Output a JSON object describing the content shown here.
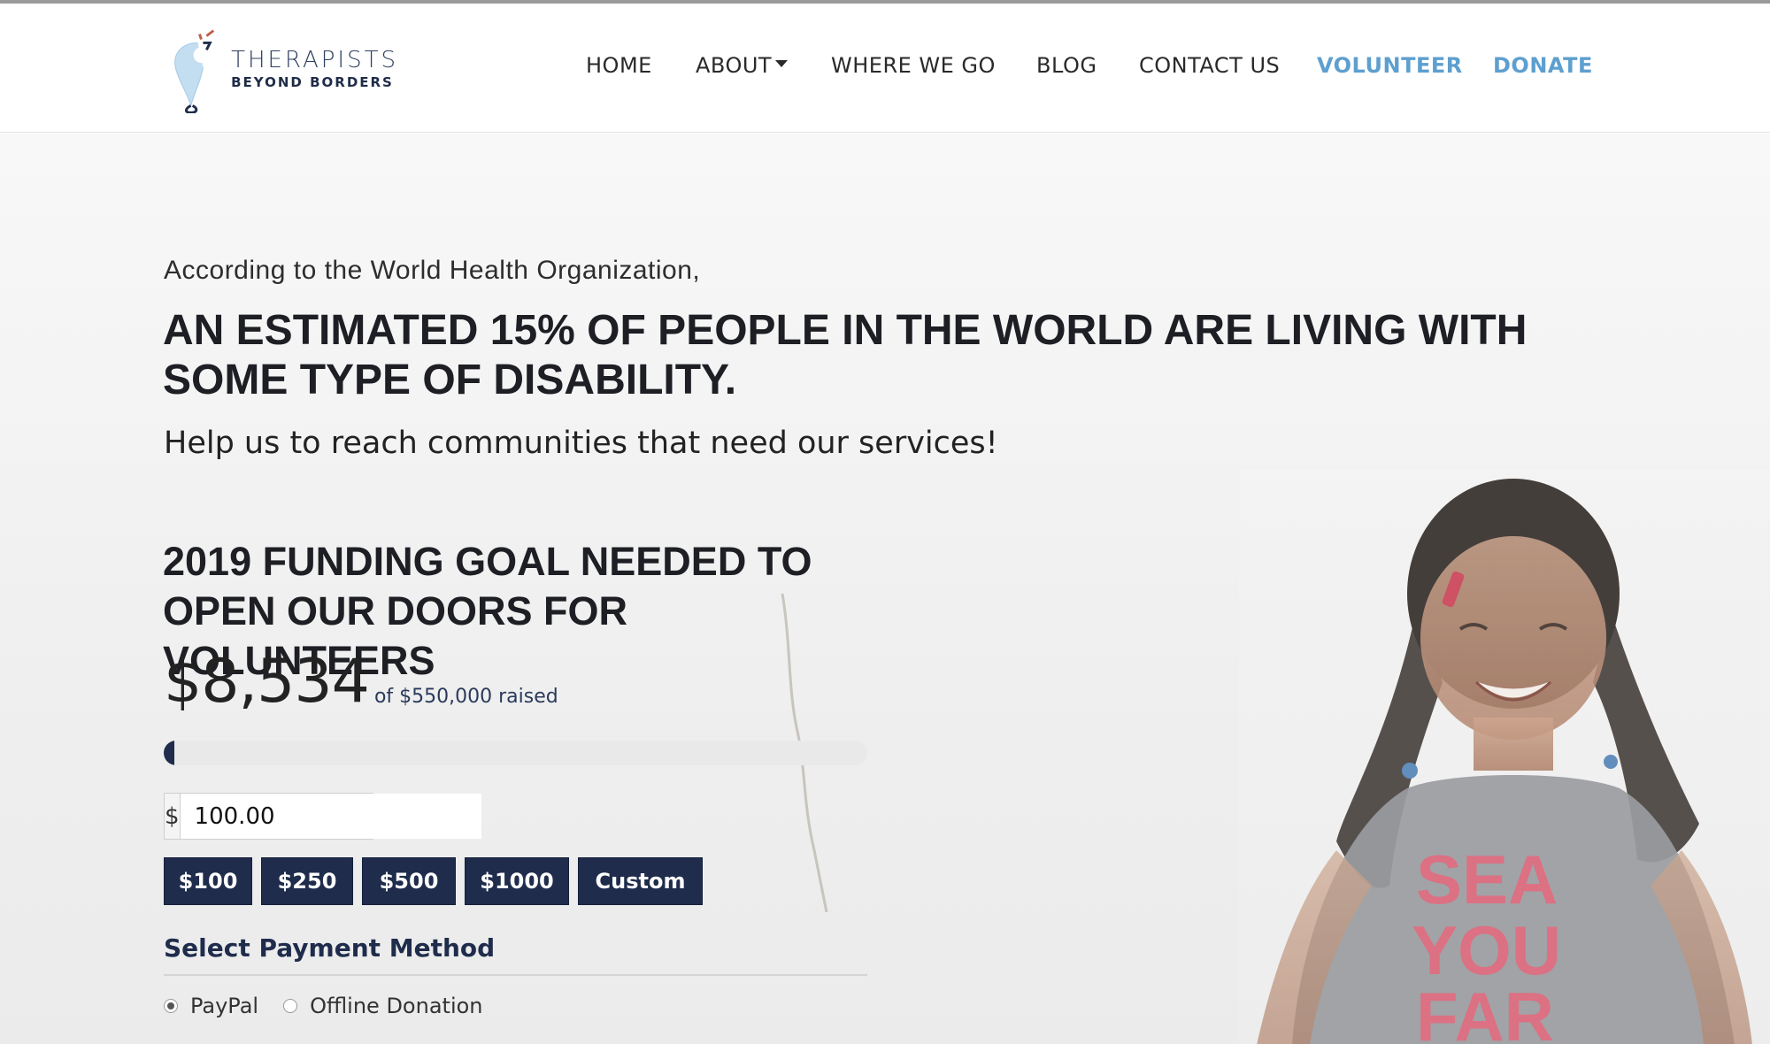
{
  "brand": {
    "line1": "THERAPISTS",
    "line2": "BEYOND BORDERS",
    "colors": {
      "navy": "#1f2c4c",
      "accent_blue": "#5d9fcf",
      "pin_blue": "#b9d7ee",
      "spark": "#c0604a"
    }
  },
  "nav": {
    "home": "HOME",
    "about": "ABOUT",
    "where_we_go": "WHERE WE GO",
    "blog": "BLOG",
    "contact": "CONTACT US",
    "volunteer": "VOLUNTEER",
    "donate": "DONATE"
  },
  "hero": {
    "intro": "According to the World Health Organization,",
    "headline": "AN ESTIMATED 15% OF PEOPLE IN THE WORLD ARE LIVING WITH SOME TYPE OF DISABILITY.",
    "help": "Help us to reach communities that need our services!",
    "tshirt_lines": [
      "SEA",
      "YOU",
      "FAR"
    ]
  },
  "donation": {
    "goal_title_line1": "2019 FUNDING GOAL NEEDED TO",
    "goal_title_line2": "OPEN OUR DOORS FOR VOLUNTEERS",
    "amount_raised": "$8,534",
    "raised_suffix": "of $550,000 raised",
    "progress_fraction": 0.0155,
    "currency_symbol": "$",
    "amount_value": "100.00",
    "levels": [
      "$100",
      "$250",
      "$500",
      "$1000",
      "Custom"
    ],
    "payment_title": "Select Payment Method",
    "payment_options": [
      {
        "label": "PayPal",
        "checked": true
      },
      {
        "label": "Offline Donation",
        "checked": false
      }
    ]
  }
}
